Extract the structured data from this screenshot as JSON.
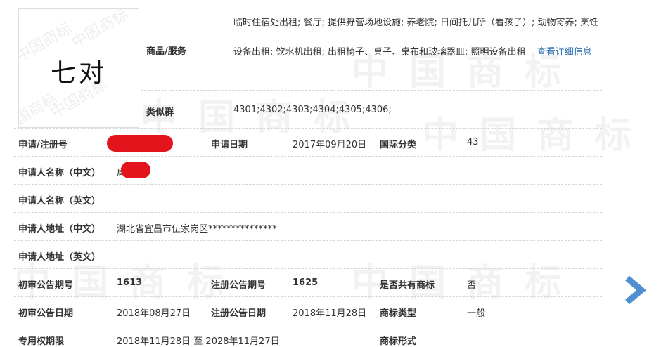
{
  "trademark": {
    "logo_text": "七对",
    "goods_label": "商品/服务",
    "goods_text": "临时住宿处出租; 餐厅; 提供野营场地设施; 养老院; 日间托儿所（看孩子）; 动物寄养; 烹饪设备出租; 饮水机出租; 出租椅子、桌子、桌布和玻璃器皿; 照明设备出租",
    "goods_more_link": "查看详细信息",
    "similar_group_label": "类似群",
    "similar_group_value": "4301;4302;4303;4304;4305;4306;"
  },
  "fields": {
    "reg_no_label": "申请/注册号",
    "apply_date_label": "申请日期",
    "apply_date_value": "2017年09月20日",
    "intl_class_label": "国际分类",
    "intl_class_value": "43",
    "applicant_cn_label": "申请人名称（中文）",
    "applicant_cn_value": "肩",
    "applicant_en_label": "申请人名称（英文）",
    "address_cn_label": "申请人地址（中文）",
    "address_cn_value": "湖北省宜昌市伍家岗区***************",
    "address_en_label": "申请人地址（英文）",
    "prelim_issue_label": "初审公告期号",
    "prelim_issue_value": "1613",
    "reg_issue_label": "注册公告期号",
    "reg_issue_value": "1625",
    "shared_label": "是否共有商标",
    "shared_value": "否",
    "prelim_date_label": "初审公告日期",
    "prelim_date_value": "2018年08月27日",
    "reg_date_label": "注册公告日期",
    "reg_date_value": "2018年11月28日",
    "tm_type_label": "商标类型",
    "tm_type_value": "一般",
    "exclusive_label": "专用权期限",
    "exclusive_value": "2018年11月28日 至 2028年11月27日",
    "tm_form_label": "商标形式"
  },
  "watermark_text": "中国商标",
  "colors": {
    "link": "#2a6fb0",
    "redaction": "#e3141b",
    "arrow": "#4f8fd0"
  },
  "icons": {
    "next": "next-arrow-icon"
  }
}
